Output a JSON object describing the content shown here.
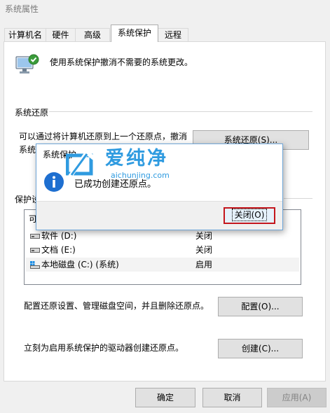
{
  "window": {
    "title": "系统属性"
  },
  "tabs": [
    {
      "label": "计算机名"
    },
    {
      "label": "硬件"
    },
    {
      "label": "高级"
    },
    {
      "label": "系统保护"
    },
    {
      "label": "远程"
    }
  ],
  "header": {
    "description": "使用系统保护撤消不需要的系统更改。"
  },
  "system_restore": {
    "section_title": "系统还原",
    "line1": "可以通过将计算机还原到上一个还原点，撤消",
    "line2": "系统",
    "button_label": "系统还原(S)..."
  },
  "protection": {
    "section_title": "保护设",
    "col_available": "可",
    "drives": [
      {
        "name": "软件 (D:)",
        "status": "关闭"
      },
      {
        "name": "文档 (E:)",
        "status": "关闭"
      },
      {
        "name": "本地磁盘 (C:) (系统)",
        "status": "启用"
      }
    ],
    "configure_text": "配置还原设置、管理磁盘空间，并且删除还原点。",
    "configure_button": "配置(O)...",
    "create_text": "立刻为启用系统保护的驱动器创建还原点。",
    "create_button": "创建(C)..."
  },
  "footer": {
    "ok": "确定",
    "cancel": "取消",
    "apply": "应用(A)"
  },
  "dialog": {
    "title": "系统保护",
    "message": "已成功创建还原点。",
    "close_button": "关闭(O)"
  },
  "watermark": {
    "text": "爱纯净",
    "url": "aichunjing.com"
  },
  "colors": {
    "info_icon": "#1e6fd0",
    "focus_border": "#c4161c",
    "accent": "#0078d7"
  }
}
